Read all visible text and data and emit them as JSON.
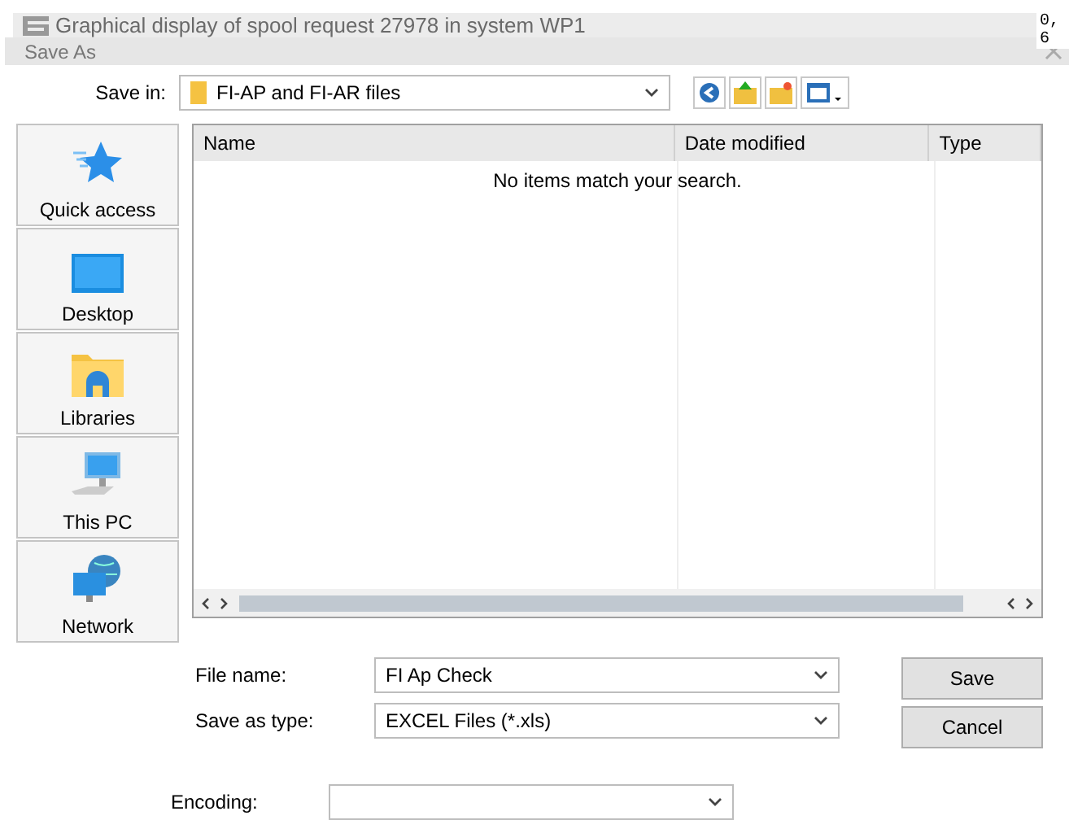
{
  "background_window": {
    "title": "Graphical display of spool request 27978 in system WP1",
    "side_text": [
      "0,",
      "6"
    ]
  },
  "dialog": {
    "title": "Save As"
  },
  "save_in": {
    "label": "Save in:",
    "value": "FI-AP and FI-AR files"
  },
  "places": [
    {
      "label": "Quick access",
      "kind": "star"
    },
    {
      "label": "Desktop",
      "kind": "desktop"
    },
    {
      "label": "Libraries",
      "kind": "libraries"
    },
    {
      "label": "This PC",
      "kind": "pc"
    },
    {
      "label": "Network",
      "kind": "network"
    }
  ],
  "file_list": {
    "columns": [
      "Name",
      "Date modified",
      "Type"
    ],
    "empty_message": "No items match your search."
  },
  "file_name": {
    "label": "File name:",
    "value": "FI Ap Check"
  },
  "save_as_type": {
    "label": "Save as type:",
    "value": "EXCEL Files (*.xls)"
  },
  "buttons": [
    "Save",
    "Cancel"
  ],
  "encoding": {
    "label": "Encoding:"
  }
}
